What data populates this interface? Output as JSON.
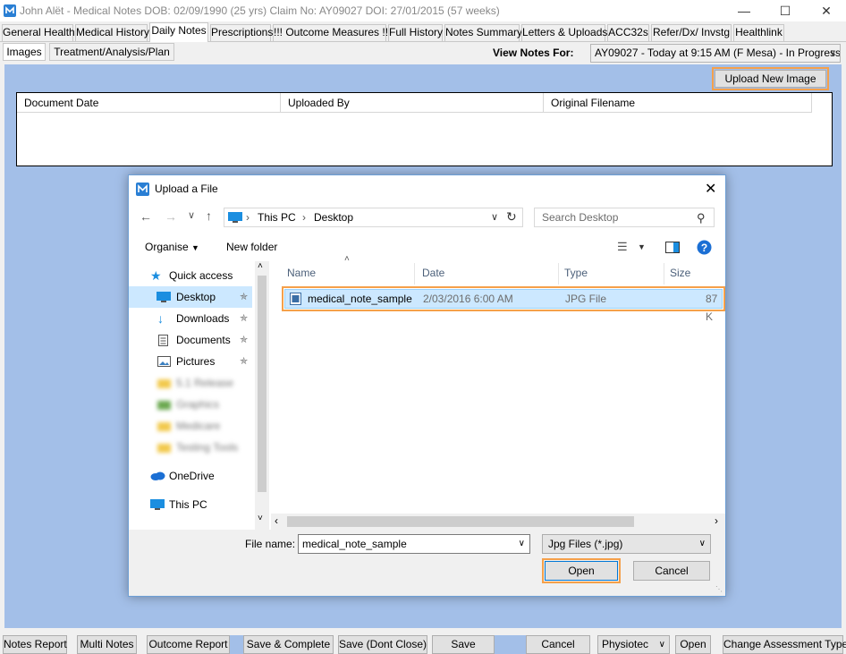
{
  "window": {
    "title": "John Alët - Medical Notes  DOB: 02/09/1990 (25 yrs)     Claim No: AY09027 DOI: 27/01/2015 (57 weeks)",
    "minimize": "—",
    "maximize": "☐",
    "close": "✕"
  },
  "tabs": [
    "General Health",
    "Medical History",
    "Daily Notes",
    "Prescriptions",
    "!!! Outcome Measures !!!",
    "Full History",
    "Notes Summary",
    "Letters & Uploads",
    "ACC32s",
    "Refer/Dx/ Invstg",
    "Healthlink"
  ],
  "active_tab": "Daily Notes",
  "subtabs": [
    "Images",
    "Treatment/Analysis/Plan"
  ],
  "active_subtab": "Images",
  "view_notes": {
    "label": "View Notes For:",
    "value": "AY09027 - Today at 9:15 AM (F Mesa) - In Progress"
  },
  "upload_button": "Upload New Image",
  "table": {
    "columns": [
      "Document Date",
      "Uploaded By",
      "Original Filename"
    ]
  },
  "dialog": {
    "title": "Upload a File",
    "close": "✕",
    "breadcrumb": [
      "This PC",
      "Desktop"
    ],
    "search_placeholder": "Search Desktop",
    "organise": "Organise",
    "new_folder": "New folder",
    "sidebar": {
      "quick_access": "Quick access",
      "items": [
        {
          "label": "Desktop",
          "selected": true,
          "pinned": true
        },
        {
          "label": "Downloads",
          "pinned": true
        },
        {
          "label": "Documents",
          "pinned": true
        },
        {
          "label": "Pictures",
          "pinned": true
        },
        {
          "label": "5.1 Release",
          "blurred": true
        },
        {
          "label": "Graphics",
          "blurred": true
        },
        {
          "label": "Medicare",
          "blurred": true
        },
        {
          "label": "Testing Tools",
          "blurred": true
        }
      ],
      "onedrive": "OneDrive",
      "thispc": "This PC"
    },
    "columns": [
      "Name",
      "Date",
      "Type",
      "Size"
    ],
    "files": [
      {
        "name": "medical_note_sample",
        "date": "2/03/2016 6:00 AM",
        "type": "JPG File",
        "size": "87 K"
      }
    ],
    "filename_label": "File name:",
    "filename_value": "medical_note_sample",
    "filter": "Jpg Files (*.jpg)",
    "open": "Open",
    "cancel": "Cancel"
  },
  "bottom_buttons": {
    "notes_report": "Notes Report",
    "multi_notes": "Multi Notes",
    "outcome_report": "Outcome Report",
    "save_complete": "Save & Complete",
    "save_dont_close": "Save (Dont Close)",
    "save": "Save",
    "cancel": "Cancel",
    "physiotec": "Physiotec",
    "open": "Open",
    "change_assessment": "Change Assessment Type"
  },
  "colors": {
    "background_blue": "#a3bfe8",
    "highlight_orange": "#f5a04a",
    "selection_blue": "#cce8ff"
  }
}
